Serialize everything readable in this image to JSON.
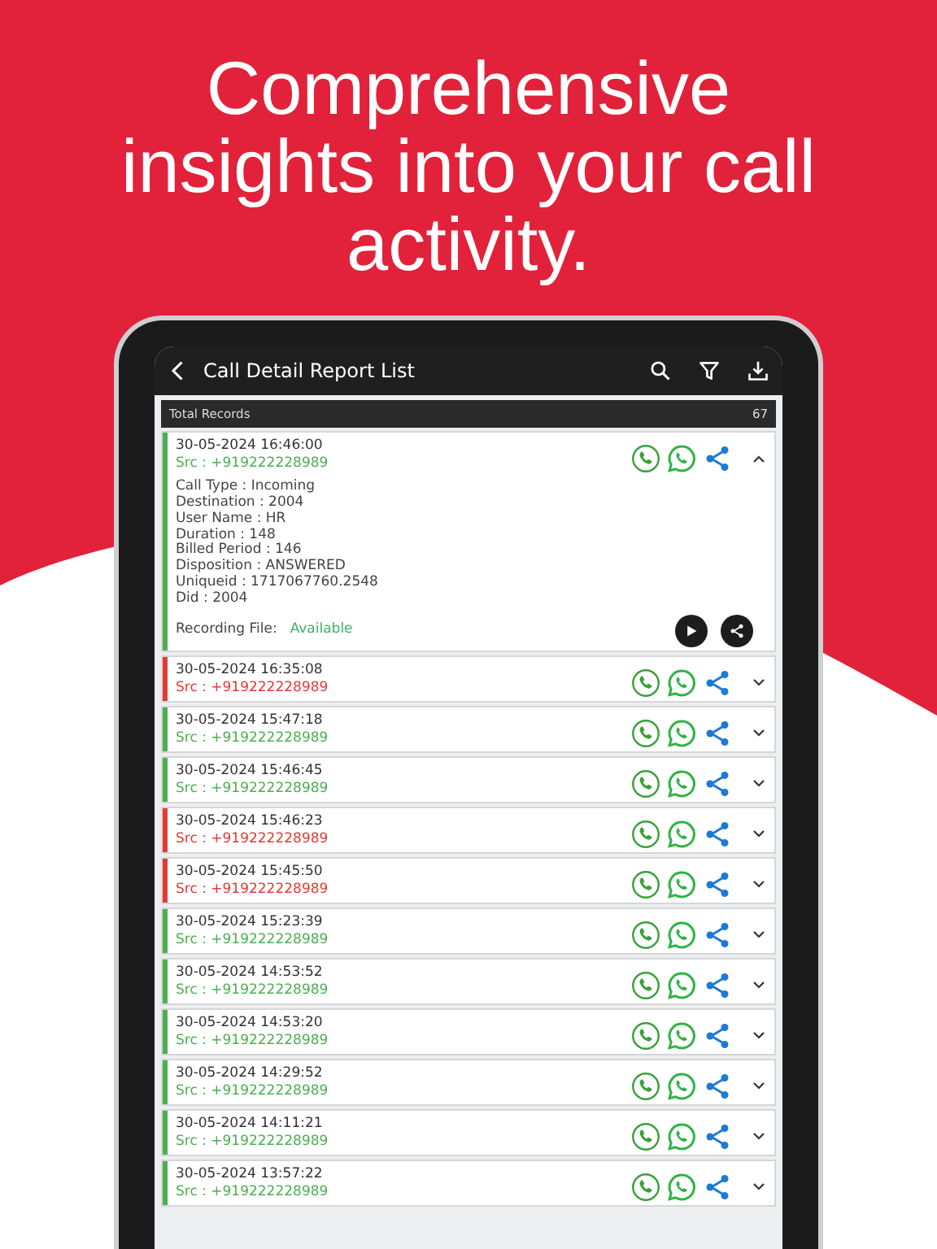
{
  "headline": "Comprehensive insights into your call activity.",
  "app_bar": {
    "title": "Call Detail Report List"
  },
  "summary": {
    "label": "Total Records",
    "count": "67"
  },
  "records": [
    {
      "datetime": "30-05-2024 16:46:00",
      "src": "Src : +919222228989",
      "color": "#4caf50",
      "expanded": true,
      "details": [
        "Call Type : Incoming",
        "Destination : 2004",
        "User Name : HR",
        "Duration : 148",
        "Billed Period : 146",
        "Disposition : ANSWERED",
        "Uniqueid : 1717067760.2548",
        "Did : 2004"
      ],
      "recording_label": "Recording File:",
      "recording_status": "Available"
    },
    {
      "datetime": "30-05-2024 16:35:08",
      "src": "Src : +919222228989",
      "color": "#e53935",
      "expanded": false
    },
    {
      "datetime": "30-05-2024 15:47:18",
      "src": "Src : +919222228989",
      "color": "#4caf50",
      "expanded": false
    },
    {
      "datetime": "30-05-2024 15:46:45",
      "src": "Src : +919222228989",
      "color": "#4caf50",
      "expanded": false
    },
    {
      "datetime": "30-05-2024 15:46:23",
      "src": "Src : +919222228989",
      "color": "#e53935",
      "expanded": false
    },
    {
      "datetime": "30-05-2024 15:45:50",
      "src": "Src : +919222228989",
      "color": "#e53935",
      "expanded": false
    },
    {
      "datetime": "30-05-2024 15:23:39",
      "src": "Src : +919222228989",
      "color": "#4caf50",
      "expanded": false
    },
    {
      "datetime": "30-05-2024 14:53:52",
      "src": "Src : +919222228989",
      "color": "#4caf50",
      "expanded": false
    },
    {
      "datetime": "30-05-2024 14:53:20",
      "src": "Src : +919222228989",
      "color": "#4caf50",
      "expanded": false
    },
    {
      "datetime": "30-05-2024 14:29:52",
      "src": "Src : +919222228989",
      "color": "#4caf50",
      "expanded": false
    },
    {
      "datetime": "30-05-2024 14:11:21",
      "src": "Src : +919222228989",
      "color": "#4caf50",
      "expanded": false
    },
    {
      "datetime": "30-05-2024 13:57:22",
      "src": "Src : +919222228989",
      "color": "#4caf50",
      "expanded": false
    }
  ]
}
